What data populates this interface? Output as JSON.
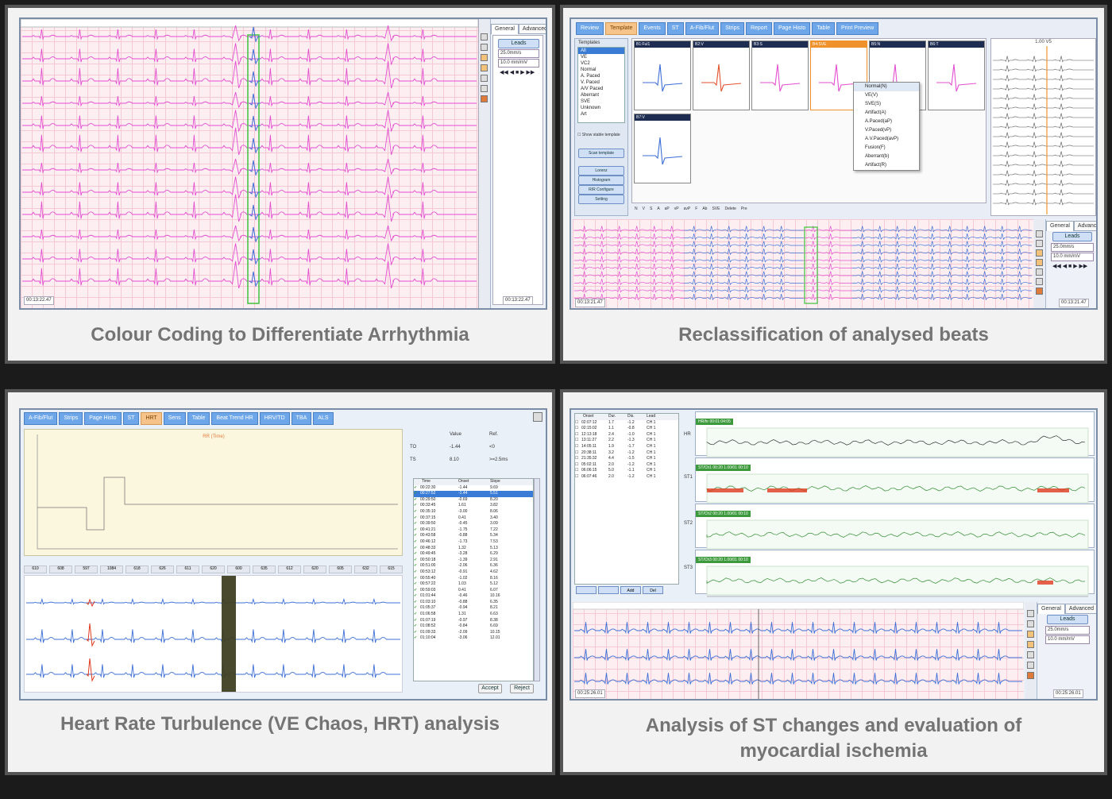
{
  "captions": {
    "p1": "Colour Coding to Differentiate Arrhythmia",
    "p2": "Reclassification of analysed beats",
    "p3": "Heart Rate Turbulence (VE Chaos, HRT) analysis",
    "p4_line1": "Analysis of ST changes and evaluation of",
    "p4_line2": "myocardial ischemia"
  },
  "colors": {
    "pink_trace": "#e34fd0",
    "blue_trace": "#3d6fd6",
    "green_trace": "#2e8b2e",
    "red_trace": "#e03a1e",
    "orange_tab": "#f6c48a",
    "blue_tab": "#6ea6ea"
  },
  "sidebar": {
    "tab_general": "General",
    "tab_advanced": "Advanced",
    "leads_button": "Leads",
    "speed_select": "25.0mm/s",
    "gain_select": "10.0 mm/mV",
    "nav_icons": "◀◀ ◀ ■ ▶ ▶▶"
  },
  "p1": {
    "time_left": "00:13:22.47",
    "time_right": "00:13:22.47"
  },
  "p2": {
    "tabs": [
      "Review",
      "Template",
      "Events",
      "ST",
      "A-Fib/Flut",
      "Strips",
      "Report",
      "Page Histo",
      "Table",
      "Print Preview"
    ],
    "active_tab": 1,
    "left_list_title": "Templates",
    "left_list": [
      "All",
      "VE",
      "VC2",
      "Normal",
      "A. Paced",
      "V. Paced",
      "A/V Paced",
      "Aberrant",
      "SVE",
      "Unknown",
      "Art"
    ],
    "left_checkbox": "Show stable template",
    "left_buttons": [
      "Scan template",
      "Lorenz",
      "Histogram",
      "R/R Configure",
      "Setting"
    ],
    "template_heads": [
      "B1:Ful1",
      "B2:V",
      "B3:S",
      "B4:SVE",
      "B5:N",
      "B6:T",
      "B7:V"
    ],
    "context_menu": [
      "Normal(N)",
      "VE(V)",
      "SVE(S)",
      "Artifact(A)",
      "A.Paced(aP)",
      "V.Paced(vP)",
      "A.V.Paced(avP)",
      "Fusion(F)",
      "Aberrant(b)",
      "Artifact(R)"
    ],
    "toolbar": [
      "N",
      "V",
      "S",
      "A",
      "aP",
      "vP",
      "avP",
      "F",
      "Ab",
      "SVE",
      "Delete",
      "Pre"
    ],
    "right_strip_title": "1.00 V5",
    "time_left": "00:13:21.47",
    "time_right": "00:13:21.47"
  },
  "p3": {
    "tabs": [
      "A-Fib/Flut",
      "Strips",
      "Page Histo",
      "ST",
      "HRT",
      "Sens",
      "Table",
      "Beat Trend HR",
      "HRV/TD",
      "TBA",
      "ALS"
    ],
    "active_tab": 4,
    "chart_label": "RR (Time)",
    "stats_header": [
      "",
      "Value",
      "Ref."
    ],
    "stats_rows": [
      [
        "TO",
        "-1.44",
        "<0"
      ],
      [
        "TS",
        "8.10",
        ">=2.5ms"
      ]
    ],
    "table_header": [
      "Time",
      "Onset",
      "Slope"
    ],
    "table_rows": [
      [
        "00:22:30",
        "-1.44",
        "9.69"
      ],
      [
        "00:27:52",
        "-1.44",
        "5.51"
      ],
      [
        "00:29:50",
        "-0.69",
        "8.20"
      ],
      [
        "00:33:45",
        "1.61",
        "3.82"
      ],
      [
        "00:35:10",
        "-3.00",
        "8.06"
      ],
      [
        "00:37:15",
        "0.41",
        "3.40"
      ],
      [
        "00:39:50",
        "-0.45",
        "3.09"
      ],
      [
        "00:41:21",
        "-1.75",
        "7.22"
      ],
      [
        "00:43:58",
        "-0.88",
        "5.34"
      ],
      [
        "00:46:12",
        "-1.73",
        "7.53"
      ],
      [
        "00:48:33",
        "1.32",
        "5.13"
      ],
      [
        "00:49:45",
        "-3.28",
        "6.29"
      ],
      [
        "00:50:18",
        "-1.39",
        "2.91"
      ],
      [
        "00:51:00",
        "-2.06",
        "6.36"
      ],
      [
        "00:53:12",
        "-0.91",
        "4.62"
      ],
      [
        "00:55:40",
        "-1.02",
        "8.16"
      ],
      [
        "00:57:22",
        "1.03",
        "5.12"
      ],
      [
        "00:59:03",
        "0.41",
        "6.07"
      ],
      [
        "01:01:44",
        "-0.46",
        "10.16"
      ],
      [
        "01:03:10",
        "-0.88",
        "6.35"
      ],
      [
        "01:05:37",
        "-0.94",
        "8.21"
      ],
      [
        "01:06:58",
        "1.31",
        "6.63"
      ],
      [
        "01:07:19",
        "-0.97",
        "8.38"
      ],
      [
        "01:08:52",
        "-0.84",
        "6.69"
      ],
      [
        "01:09:33",
        "-2.09",
        "10.15"
      ],
      [
        "01:10:04",
        "-3.06",
        "12.01"
      ]
    ],
    "selected_row": 1,
    "accept_button": "Accept",
    "reject_button": "Reject",
    "beat_labels": [
      "610",
      "608",
      "597",
      "1084",
      "618",
      "626",
      "611",
      "620",
      "600",
      "635",
      "612",
      "620",
      "605",
      "632",
      "615"
    ]
  },
  "p4": {
    "list_header": [
      "Onset",
      "Dur.",
      "Dis.",
      "Lead"
    ],
    "list_rows": [
      [
        "02:07:12",
        "1.7",
        "-1.2",
        "CH 1"
      ],
      [
        "02:15:02",
        "1.1",
        "-0.8",
        "CH 1"
      ],
      [
        "12:13:18",
        "2.4",
        "-1.0",
        "CH 1"
      ],
      [
        "13:11:27",
        "2.2",
        "-1.3",
        "CH 1"
      ],
      [
        "14:05:11",
        "1.9",
        "-1.7",
        "CH 1"
      ],
      [
        "20:38:11",
        "3.2",
        "-1.2",
        "CH 1"
      ],
      [
        "21:35:32",
        "4.4",
        "-1.5",
        "CH 1"
      ],
      [
        "05:02:11",
        "2.0",
        "-1.2",
        "CH 1"
      ],
      [
        "06:06:15",
        "5.0",
        "-1.1",
        "CH 1"
      ],
      [
        "06:07:46",
        "2.0",
        "-1.2",
        "CH 1"
      ]
    ],
    "list_buttons": [
      "",
      "",
      "Add",
      "Del"
    ],
    "hr_strip_title": "HR/hr  00:01:04:05",
    "st_strip_titles": [
      "ST/Ch1 00:20  1.00/01 00:10",
      "ST/Ch2 00:20  1.00/01 00:10",
      "ST/Ch3 00:20  1.00/01 00:10"
    ],
    "row_labels": [
      "HR",
      "ST1",
      "ST2",
      "ST3"
    ],
    "time_left": "00:25:26.01",
    "time_right": "00:25:26.01"
  }
}
